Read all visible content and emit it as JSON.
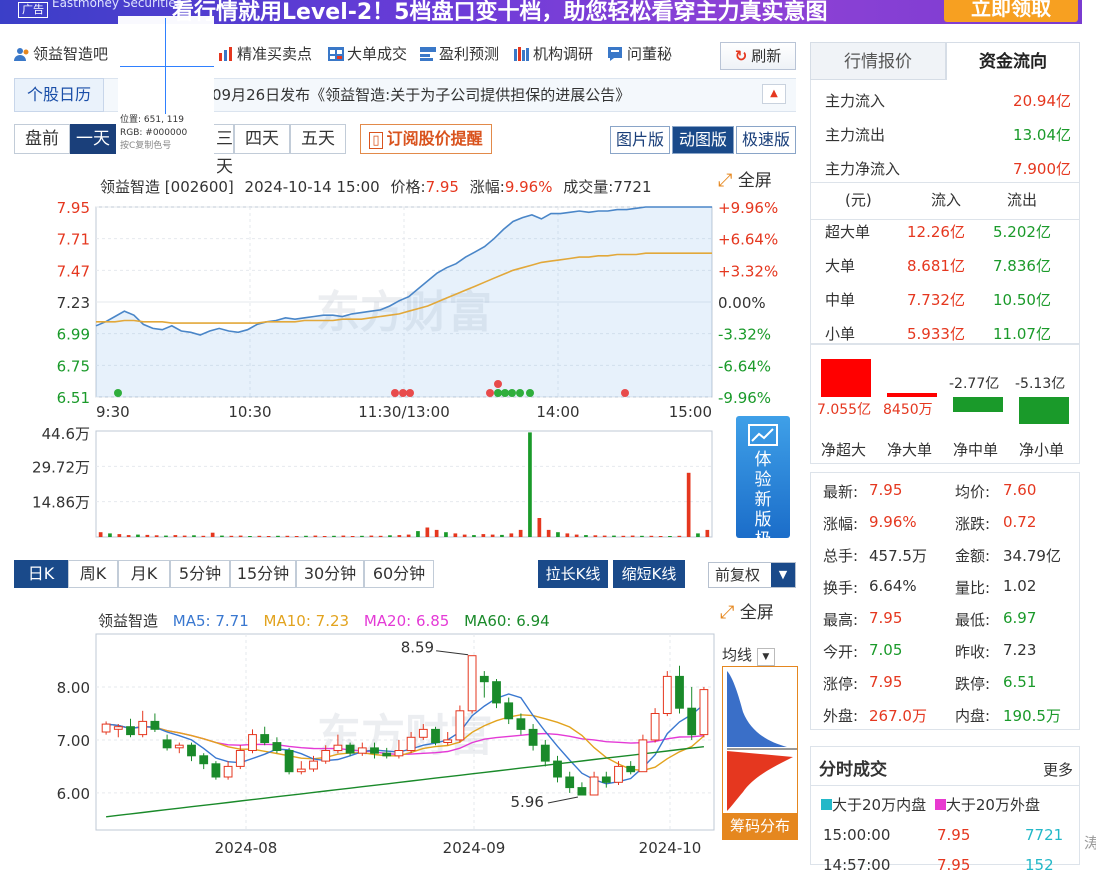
{
  "banner": {
    "ad_label": "广告",
    "logo_text": "Eastmoney Securities",
    "headline": "看行情就用Level-2！5档盘口变十档，助您轻松看穿主力真实意图",
    "cta": "立即领取"
  },
  "toolbar": {
    "items": [
      "领益智造吧",
      "精准买卖点",
      "大单成交",
      "盈利预测",
      "机构调研",
      "问董秘"
    ],
    "refresh": "刷新"
  },
  "notice": {
    "calendar": "个股日历",
    "text": "09月26日发布《领益智造:关于为子公司提供担保的进展公告》"
  },
  "crosshair": {
    "position": "位置: 651, 119",
    "rgb": "RGB: #000000",
    "hint": "按C复制色号"
  },
  "day_tabs": [
    "盘前",
    "一天",
    "二天",
    "三天",
    "四天",
    "五天"
  ],
  "subscribe": "订阅股价提醒",
  "view_tabs": [
    "图片版",
    "动图版",
    "极速版"
  ],
  "intraday": {
    "header": {
      "name": "领益智造",
      "code": "[002600]",
      "datetime": "2024-10-14 15:00",
      "price_label": "价格:",
      "price": "7.95",
      "change_label": "涨幅:",
      "change": "9.96%",
      "volume_label": "成交量:",
      "volume": "7721"
    },
    "fullscreen": "全屏",
    "watermark": "东方财富"
  },
  "promo": "体验新版极速行情",
  "kline_tabs": [
    "日K",
    "周K",
    "月K",
    "5分钟",
    "15分钟",
    "30分钟",
    "60分钟"
  ],
  "kline_buttons": [
    "拉长K线",
    "缩短K线"
  ],
  "adjust": "前复权",
  "kline": {
    "name": "领益智造",
    "ma5": "MA5: 7.71",
    "ma10": "MA10: 7.23",
    "ma20": "MA20: 6.85",
    "ma60": "MA60: 6.94",
    "fullscreen": "全屏",
    "ma_select": "均线",
    "chip": "筹码分布",
    "high_label": "8.59",
    "low_label": "5.96",
    "watermark": "东方财富"
  },
  "colors": {
    "up": "#e5371f",
    "down": "#1a9a2a",
    "accent": "#1a3f7a",
    "line": "#4a86c8",
    "avg": "#e2a83a"
  },
  "chart_data": [
    {
      "type": "line",
      "title": "领益智造 [002600] 2024-10-14 15:00",
      "x_ticks": [
        "9:30",
        "10:30",
        "11:30/13:00",
        "14:00",
        "15:00"
      ],
      "y_ticks_left": [
        "7.95",
        "7.71",
        "7.47",
        "7.23",
        "6.99",
        "6.75",
        "6.51"
      ],
      "y_ticks_right": [
        "+9.96%",
        "+6.64%",
        "+3.32%",
        "0.00%",
        "-3.32%",
        "-6.64%",
        "-9.96%"
      ],
      "ylim": [
        6.51,
        7.95
      ],
      "prev_close": 7.23,
      "series": [
        {
          "values": [
            7.05,
            7.08,
            7.12,
            7.16,
            7.13,
            7.06,
            7.03,
            7.02,
            7.05,
            7.01,
            7.0,
            6.98,
            7.01,
            7.03,
            7.01,
            7.0,
            7.02,
            7.06,
            7.08,
            7.09,
            7.11,
            7.1,
            7.11,
            7.12,
            7.13,
            7.13,
            7.12,
            7.14,
            7.15,
            7.16,
            7.17,
            7.2,
            7.24,
            7.27,
            7.33,
            7.39,
            7.45,
            7.49,
            7.52,
            7.57,
            7.61,
            7.65,
            7.71,
            7.78,
            7.84,
            7.87,
            7.89,
            7.86,
            7.9,
            7.9,
            7.91,
            7.92,
            7.91,
            7.92,
            7.92,
            7.93,
            7.93,
            7.94,
            7.95,
            7.95,
            7.95,
            7.95,
            7.95,
            7.95,
            7.95,
            7.95
          ]
        },
        {
          "values": [
            7.08,
            7.08,
            7.08,
            7.09,
            7.09,
            7.08,
            7.08,
            7.08,
            7.07,
            7.07,
            7.07,
            7.07,
            7.07,
            7.07,
            7.07,
            7.07,
            7.07,
            7.07,
            7.08,
            7.08,
            7.08,
            7.08,
            7.09,
            7.09,
            7.09,
            7.09,
            7.1,
            7.1,
            7.1,
            7.11,
            7.12,
            7.13,
            7.14,
            7.16,
            7.18,
            7.2,
            7.23,
            7.26,
            7.29,
            7.32,
            7.35,
            7.38,
            7.41,
            7.44,
            7.47,
            7.49,
            7.51,
            7.53,
            7.54,
            7.55,
            7.56,
            7.57,
            7.57,
            7.58,
            7.58,
            7.59,
            7.59,
            7.59,
            7.6,
            7.6,
            7.6,
            7.6,
            7.6,
            7.6,
            7.6,
            7.6
          ]
        }
      ]
    },
    {
      "type": "bar",
      "title": "volume",
      "y_ticks": [
        "44.6万",
        "29.72万",
        "14.86万"
      ],
      "ylim": [
        0,
        44.6
      ],
      "values": [
        2,
        1.5,
        1.2,
        0.8,
        1,
        0.9,
        0.7,
        0.6,
        0.8,
        0.6,
        0.7,
        0.5,
        1.8,
        0.6,
        0.5,
        0.6,
        0.4,
        0.5,
        0.4,
        0.5,
        0.5,
        0.4,
        0.5,
        0.6,
        0.4,
        0.5,
        0.6,
        0.4,
        0.5,
        0.6,
        0.5,
        0.7,
        0.8,
        1.0,
        2.5,
        4.0,
        3.0,
        2.0,
        1.5,
        1.0,
        0.8,
        1.2,
        1.0,
        0.9,
        1.5,
        3.0,
        44.0,
        8.0,
        3.0,
        2.0,
        1.5,
        1.0,
        0.8,
        0.7,
        0.6,
        0.6,
        0.5,
        0.6,
        0.5,
        0.5,
        0.4,
        0.4,
        0.5,
        27.0,
        1.5,
        3.0
      ]
    },
    {
      "type": "candlestick",
      "title": "领益智造",
      "x_ticks": [
        "2024-08",
        "2024-09",
        "2024-10"
      ],
      "y_ticks": [
        "8.00",
        "7.00",
        "6.00"
      ],
      "ylim": [
        5.3,
        9.0
      ],
      "candles": [
        [
          7.15,
          7.3,
          7.35,
          7.1
        ],
        [
          7.2,
          7.25,
          7.3,
          7.05
        ],
        [
          7.25,
          7.1,
          7.4,
          7.05
        ],
        [
          7.1,
          7.35,
          7.55,
          7.05
        ],
        [
          7.35,
          7.2,
          7.5,
          7.15
        ],
        [
          7.0,
          6.85,
          7.1,
          6.8
        ],
        [
          6.85,
          6.9,
          6.95,
          6.75
        ],
        [
          6.9,
          6.7,
          6.95,
          6.6
        ],
        [
          6.7,
          6.55,
          6.75,
          6.45
        ],
        [
          6.55,
          6.3,
          6.6,
          6.25
        ],
        [
          6.3,
          6.5,
          6.6,
          6.25
        ],
        [
          6.5,
          6.8,
          6.9,
          6.45
        ],
        [
          6.8,
          7.1,
          7.2,
          6.75
        ],
        [
          7.1,
          6.95,
          7.25,
          6.9
        ],
        [
          6.95,
          6.8,
          7.05,
          6.75
        ],
        [
          6.8,
          6.4,
          6.85,
          6.35
        ],
        [
          6.4,
          6.45,
          6.6,
          6.35
        ],
        [
          6.45,
          6.6,
          6.7,
          6.4
        ],
        [
          6.6,
          6.8,
          6.9,
          6.55
        ],
        [
          6.8,
          6.9,
          7.1,
          6.75
        ],
        [
          6.9,
          6.75,
          6.95,
          6.7
        ],
        [
          6.75,
          6.85,
          6.95,
          6.7
        ],
        [
          6.85,
          6.75,
          6.95,
          6.65
        ],
        [
          6.75,
          6.7,
          6.85,
          6.65
        ],
        [
          6.7,
          6.8,
          7.0,
          6.65
        ],
        [
          6.8,
          7.05,
          7.15,
          6.75
        ],
        [
          7.05,
          7.2,
          7.3,
          7.0
        ],
        [
          7.2,
          6.95,
          7.25,
          6.9
        ],
        [
          6.95,
          7.0,
          7.15,
          6.9
        ],
        [
          7.0,
          7.55,
          7.65,
          6.95
        ],
        [
          7.55,
          8.59,
          8.59,
          7.5
        ],
        [
          8.2,
          8.1,
          8.3,
          7.8
        ],
        [
          8.1,
          7.7,
          8.15,
          7.6
        ],
        [
          7.7,
          7.4,
          7.8,
          7.3
        ],
        [
          7.4,
          7.2,
          7.5,
          7.1
        ],
        [
          7.2,
          6.9,
          7.3,
          6.8
        ],
        [
          6.9,
          6.6,
          7.0,
          6.5
        ],
        [
          6.6,
          6.3,
          6.7,
          6.2
        ],
        [
          6.3,
          6.1,
          6.4,
          6.0
        ],
        [
          6.1,
          5.96,
          6.2,
          5.96
        ],
        [
          5.96,
          6.3,
          6.4,
          5.96
        ],
        [
          6.3,
          6.2,
          6.4,
          6.1
        ],
        [
          6.2,
          6.5,
          6.6,
          6.15
        ],
        [
          6.5,
          6.4,
          6.6,
          6.35
        ],
        [
          6.4,
          7.0,
          7.1,
          6.4
        ],
        [
          7.0,
          7.5,
          7.6,
          6.95
        ],
        [
          7.5,
          8.2,
          8.3,
          7.45
        ],
        [
          8.2,
          7.6,
          8.4,
          7.5
        ],
        [
          7.6,
          7.1,
          8.0,
          7.0
        ],
        [
          7.1,
          7.95,
          8.0,
          7.05
        ]
      ]
    }
  ],
  "right_panel": {
    "tabs": [
      "行情报价",
      "资金流向"
    ],
    "main_flow": [
      {
        "label": "主力流入",
        "value": "20.94亿",
        "color": "red"
      },
      {
        "label": "主力流出",
        "value": "13.04亿",
        "color": "green"
      },
      {
        "label": "主力净流入",
        "value": "7.900亿",
        "color": "red"
      }
    ],
    "order_header": [
      "(元)",
      "流入",
      "流出"
    ],
    "orders": [
      {
        "label": "超大单",
        "in": "12.26亿",
        "out": "5.202亿"
      },
      {
        "label": "大单",
        "in": "8.681亿",
        "out": "7.836亿"
      },
      {
        "label": "中单",
        "in": "7.732亿",
        "out": "10.50亿"
      },
      {
        "label": "小单",
        "in": "5.933亿",
        "out": "11.07亿"
      }
    ],
    "net_bars": [
      {
        "label": "净超大",
        "value": "7.055亿",
        "amount": 7.055
      },
      {
        "label": "净大单",
        "value": "8450万",
        "amount": 0.845
      },
      {
        "label": "净中单",
        "value": "-2.77亿",
        "amount": -2.77
      },
      {
        "label": "净小单",
        "value": "-5.13亿",
        "amount": -5.13
      }
    ],
    "quote": [
      {
        "l": "最新:",
        "lv": "7.95",
        "lc": "red",
        "r": "均价:",
        "rv": "7.60",
        "rc": "red"
      },
      {
        "l": "涨幅:",
        "lv": "9.96%",
        "lc": "red",
        "r": "涨跌:",
        "rv": "0.72",
        "rc": "red"
      },
      {
        "l": "总手:",
        "lv": "457.5万",
        "lc": "",
        "r": "金额:",
        "rv": "34.79亿",
        "rc": ""
      },
      {
        "l": "换手:",
        "lv": "6.64%",
        "lc": "",
        "r": "量比:",
        "rv": "1.02",
        "rc": ""
      },
      {
        "l": "最高:",
        "lv": "7.95",
        "lc": "red",
        "r": "最低:",
        "rv": "6.97",
        "rc": "green"
      },
      {
        "l": "今开:",
        "lv": "7.05",
        "lc": "green",
        "r": "昨收:",
        "rv": "7.23",
        "rc": ""
      },
      {
        "l": "涨停:",
        "lv": "7.95",
        "lc": "red",
        "r": "跌停:",
        "rv": "6.51",
        "rc": "green"
      },
      {
        "l": "外盘:",
        "lv": "267.0万",
        "lc": "red",
        "r": "内盘:",
        "rv": "190.5万",
        "rc": "green"
      }
    ],
    "ticks_title": "分时成交",
    "ticks_more": "更多",
    "legend_in": "大于20万内盘",
    "legend_out": "大于20万外盘",
    "ticks": [
      {
        "time": "15:00:00",
        "price": "7.95",
        "vol": "7721"
      },
      {
        "time": "14:57:00",
        "price": "7.95",
        "vol": "152"
      }
    ],
    "side_label": "涛"
  }
}
